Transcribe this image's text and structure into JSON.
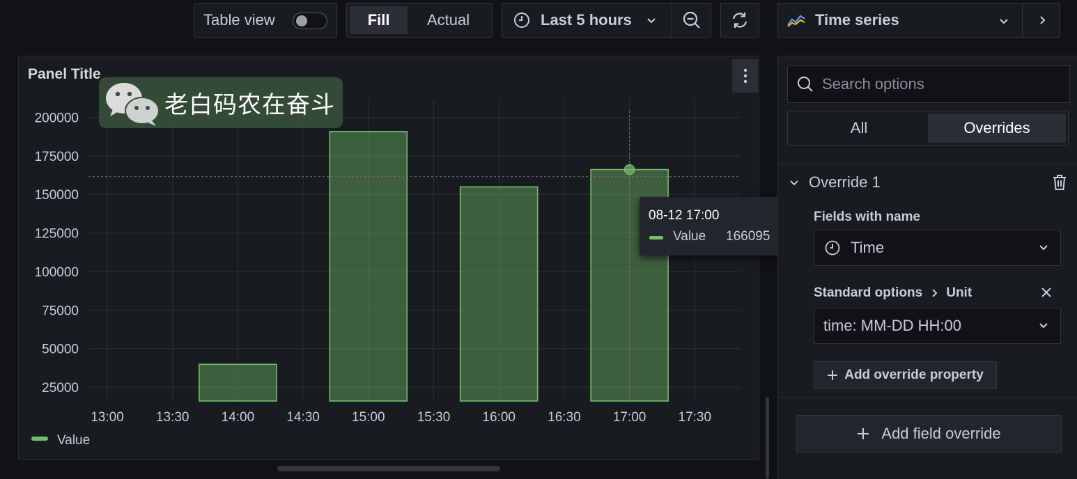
{
  "toolbar": {
    "table_view_label": "Table view",
    "fill_label": "Fill",
    "actual_label": "Actual",
    "time_range_label": "Last 5 hours",
    "viz_label": "Time series"
  },
  "panel": {
    "title": "Panel Title",
    "watermark_text": "老白码农在奋斗"
  },
  "chart_data": {
    "type": "bar",
    "x_ticks": [
      "13:00",
      "13:30",
      "14:00",
      "14:30",
      "15:00",
      "15:30",
      "16:00",
      "16:30",
      "17:00",
      "17:30"
    ],
    "y_ticks": [
      25000,
      50000,
      75000,
      100000,
      125000,
      150000,
      175000,
      200000
    ],
    "ylim": [
      16000,
      211500
    ],
    "series": [
      {
        "name": "Value",
        "color": "#73bf69",
        "points": [
          {
            "x": "14:00",
            "y": 39800
          },
          {
            "x": "15:00",
            "y": 190800
          },
          {
            "x": "16:00",
            "y": 154900
          },
          {
            "x": "17:00",
            "y": 166095
          }
        ]
      }
    ],
    "legend": "bottom-left",
    "grid": true,
    "hover": {
      "x": "17:00",
      "y": 161500
    }
  },
  "tooltip": {
    "time": "08-12 17:00",
    "series_name": "Value",
    "value": "166095"
  },
  "options_pane": {
    "search_placeholder": "Search options",
    "tab_all": "All",
    "tab_overrides": "Overrides",
    "override_title": "Override 1",
    "matcher_label": "Fields with name",
    "matcher_value": "Time",
    "property_label": "Standard options",
    "property_sub": "Unit",
    "property_value": "time: MM-DD HH:00",
    "add_property_label": "Add override property",
    "add_field_override_label": "Add field override"
  }
}
